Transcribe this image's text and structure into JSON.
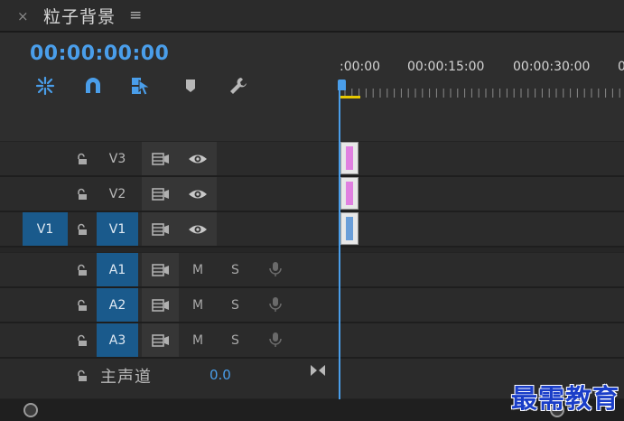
{
  "panel": {
    "close": "×",
    "title": "粒子背景",
    "menu": "≡"
  },
  "timecode": "00:00:00:00",
  "tools": [
    {
      "name": "nest-sequence-icon"
    },
    {
      "name": "snap-icon"
    },
    {
      "name": "linked-selection-icon"
    },
    {
      "name": "add-marker-icon"
    },
    {
      "name": "settings-wrench-icon"
    }
  ],
  "ruler": {
    "labels": [
      ":00:00",
      "00:00:15:00",
      "00:00:30:00",
      "0"
    ]
  },
  "video_tracks": [
    {
      "source": "",
      "label": "V3",
      "clip_color": "#e080e0"
    },
    {
      "source": "",
      "label": "V2",
      "clip_color": "#e080e0"
    },
    {
      "source": "V1",
      "label": "V1",
      "clip_color": "#6a9ed8"
    }
  ],
  "audio_tracks": [
    {
      "label": "A1",
      "mute": "M",
      "solo": "S"
    },
    {
      "label": "A2",
      "mute": "M",
      "solo": "S"
    },
    {
      "label": "A3",
      "mute": "M",
      "solo": "S"
    }
  ],
  "master": {
    "label": "主声道",
    "value": "0.0"
  },
  "watermark": "最需教育",
  "colors": {
    "accent": "#4a9eea",
    "active_track": "#1a5a8c",
    "playhead_range": "#e6c800"
  }
}
